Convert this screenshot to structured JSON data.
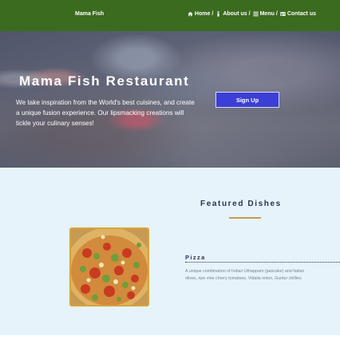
{
  "navbar": {
    "brand": "Mama Fish",
    "links": [
      {
        "label": "Home",
        "icon": "home-icon",
        "sep": "/"
      },
      {
        "label": "About us",
        "icon": "info-icon",
        "sep": "/"
      },
      {
        "label": "Menu",
        "icon": "list-icon",
        "sep": "/"
      },
      {
        "label": "Contact us",
        "icon": "contact-card-icon",
        "sep": ""
      }
    ]
  },
  "hero": {
    "title": "Mama Fish Restaurant",
    "text": "We take inspiration from the World's best cuisines, and create a unique fusion experience. Our lipsmacking creations will tickle your culinary senses!",
    "signup_label": "Sign Up"
  },
  "featured": {
    "title": "Featured Dishes",
    "dish": {
      "name": "Pizza",
      "desc_line1": "A unique combination of Indian Uthappam (pancake) and Italian",
      "desc_line2": "olives, ripe vine cherry tomatoes, Vidalia onion, Guntur chillies"
    }
  },
  "colors": {
    "navbar": "#3b6b1f",
    "button": "#3b3fd6",
    "featured_bg": "#e6f3fb",
    "accent_rule": "#c49a52"
  }
}
